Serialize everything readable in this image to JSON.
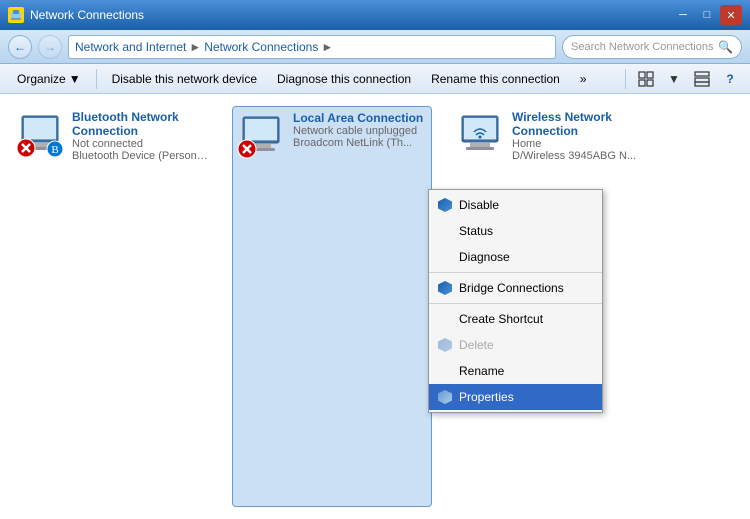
{
  "titleBar": {
    "title": "Network Connections",
    "minBtn": "─",
    "maxBtn": "□",
    "closeBtn": "✕"
  },
  "addressBar": {
    "breadcrumbs": [
      "Network and Internet",
      "Network Connections"
    ],
    "searchPlaceholder": "Search Network Connections"
  },
  "toolbar": {
    "organizeLabel": "Organize",
    "disableLabel": "Disable this network device",
    "diagnoseLabel": "Diagnose this connection",
    "renameLabel": "Rename this connection",
    "moreLabel": "»"
  },
  "networks": [
    {
      "name": "Bluetooth Network Connection",
      "status": "Not connected",
      "device": "Bluetooth Device (Personal Area ...",
      "connected": false,
      "selected": false
    },
    {
      "name": "Local Area Connection",
      "status": "Network cable unplugged",
      "device": "Broadcom NetLink (Th...",
      "connected": false,
      "selected": true
    },
    {
      "name": "Wireless Network Connection",
      "status": "Home",
      "device": "D/Wireless 3945ABG N...",
      "connected": true,
      "selected": false
    }
  ],
  "contextMenu": {
    "items": [
      {
        "label": "Disable",
        "icon": "shield",
        "enabled": true,
        "highlighted": false
      },
      {
        "label": "Status",
        "icon": null,
        "enabled": true,
        "highlighted": false
      },
      {
        "label": "Diagnose",
        "icon": null,
        "enabled": true,
        "highlighted": false
      },
      {
        "separator": true
      },
      {
        "label": "Bridge Connections",
        "icon": "shield",
        "enabled": true,
        "highlighted": false
      },
      {
        "separator": true
      },
      {
        "label": "Create Shortcut",
        "icon": null,
        "enabled": true,
        "highlighted": false
      },
      {
        "label": "Delete",
        "icon": null,
        "enabled": false,
        "highlighted": false
      },
      {
        "label": "Rename",
        "icon": null,
        "enabled": true,
        "highlighted": false
      },
      {
        "label": "Properties",
        "icon": "shield",
        "enabled": true,
        "highlighted": true
      }
    ]
  }
}
